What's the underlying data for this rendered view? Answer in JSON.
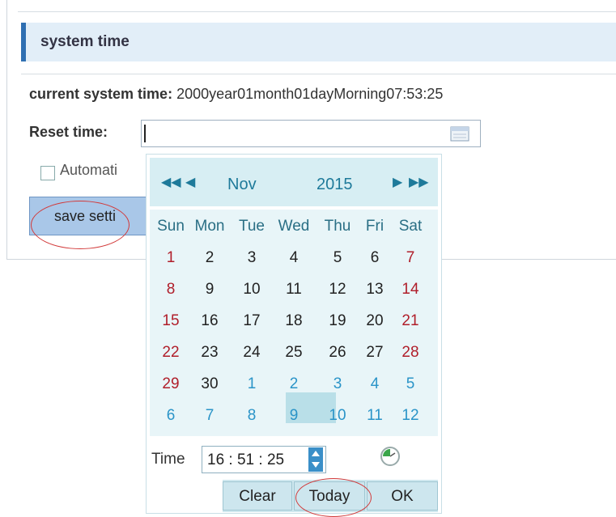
{
  "section": {
    "title": "system time"
  },
  "current_time": {
    "label": "current system time:",
    "value": "2000year01month01dayMorning07:53:25"
  },
  "reset_time": {
    "label": "Reset time:",
    "value": ""
  },
  "auto": {
    "label": "Automati"
  },
  "save_button": {
    "label": "save setti"
  },
  "picker": {
    "month": "Nov",
    "year": "2015",
    "weekdays": [
      "Sun",
      "Mon",
      "Tue",
      "Wed",
      "Thu",
      "Fri",
      "Sat"
    ],
    "weeks": [
      [
        "1",
        "2",
        "3",
        "4",
        "5",
        "6",
        "7"
      ],
      [
        "8",
        "9",
        "10",
        "11",
        "12",
        "13",
        "14"
      ],
      [
        "15",
        "16",
        "17",
        "18",
        "19",
        "20",
        "21"
      ],
      [
        "22",
        "23",
        "24",
        "25",
        "26",
        "27",
        "28"
      ],
      [
        "29",
        "30",
        "1",
        "2",
        "3",
        "4",
        "5"
      ],
      [
        "6",
        "7",
        "8",
        "9",
        "10",
        "11",
        "12"
      ]
    ],
    "selected_day": "25",
    "time_label": "Time",
    "time_value": "16 : 51 : 25",
    "buttons": {
      "clear": "Clear",
      "today": "Today",
      "ok": "OK"
    }
  },
  "colors": {
    "header_bar": "#e2eef8",
    "accent": "#2f6fb2",
    "weekend": "#b01e2a",
    "other_month": "#2a94c8",
    "highlight_circle": "#d23a3a"
  }
}
